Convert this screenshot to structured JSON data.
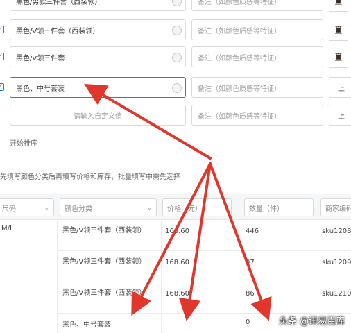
{
  "form": {
    "rows": [
      {
        "checked": true,
        "name_value": "黑色/男款三件套（西装领）",
        "name_placeholder": "",
        "note_placeholder": "备注（如颜色质感等特征）"
      },
      {
        "checked": true,
        "name_value": "黑色/V领三件套（西装领）",
        "name_placeholder": "",
        "note_placeholder": "备注（如颜色质感等特征）"
      },
      {
        "checked": true,
        "name_value": "黑色/V领三件套",
        "name_placeholder": "",
        "note_placeholder": "备注（如颜色质感等特征）"
      },
      {
        "checked": true,
        "name_value": "黑色、中号套装",
        "name_placeholder": "",
        "note_placeholder": "备注（如颜色质感等特征）"
      },
      {
        "checked": false,
        "name_value": "",
        "name_placeholder": "请输入自定义值",
        "note_placeholder": "备注（如颜色质感等特征）"
      }
    ],
    "side_label": "上",
    "add_link": "开始排序",
    "info_text": "先填写颜色分类后再填写价格和库存，批量填写中需先选择",
    "table": {
      "headers": {
        "size": "尺码",
        "color": "颜色分类",
        "price": "价格（元）",
        "stock": "数量（件）",
        "code": "商家编码"
      },
      "left_cell": "M/L",
      "rows": [
        {
          "color": "黑色/V领三件套（西装领）",
          "price": "168.60",
          "stock": "446",
          "code": "sku1208"
        },
        {
          "color": "黑色/V领三件套（西装领）",
          "price": "168.60",
          "stock": "97",
          "code": "sku1209"
        },
        {
          "color": "黑色/V领三件套（西装领）",
          "price": "168.60",
          "stock": "86",
          "code": "sku1210"
        },
        {
          "color": "黑色、中号套装",
          "price": "",
          "stock": "0",
          "code": ""
        }
      ]
    }
  },
  "watermark": {
    "text": "头条 @讯易百库"
  },
  "colors": {
    "accent": "#2b7bd8",
    "arrow": "#e0362c"
  }
}
